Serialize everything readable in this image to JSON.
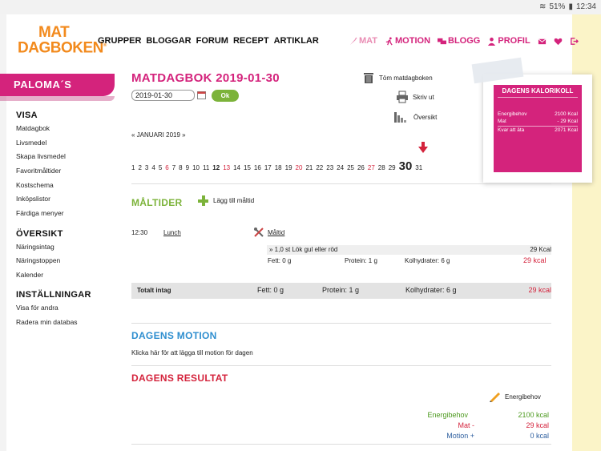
{
  "status": {
    "battery": "51%",
    "time": "12:34"
  },
  "logo": {
    "line1": "MAT",
    "line2": "DAGBOKEN",
    "reg": "®"
  },
  "main_nav": [
    "GRUPPER",
    "BLOGGAR",
    "FORUM",
    "RECEPT",
    "ARTIKLAR"
  ],
  "user_nav": {
    "mat": "MAT",
    "motion": "MOTION",
    "blogg": "BLOGG",
    "profil": "PROFIL"
  },
  "sidebar": {
    "user": "PALOMA´S",
    "visa_heading": "VISA",
    "visa_items": [
      "Matdagbok",
      "Livsmedel",
      "Skapa livsmedel",
      "Favoritmåltider",
      "Kostschema",
      "Inköpslistor",
      "Färdiga menyer"
    ],
    "oversikt_heading": "ÖVERSIKT",
    "oversikt_items": [
      "Näringsintag",
      "Näringstoppen",
      "Kalender"
    ],
    "installningar_heading": "INSTÄLLNINGAR",
    "installningar_items": [
      "Visa för andra",
      "Radera min databas"
    ]
  },
  "page": {
    "title": "MATDAGBOK 2019-01-30",
    "date_value": "2019-01-30",
    "ok_label": "Ok",
    "tools": {
      "clear": "Töm matdagboken",
      "print": "Skriv ut",
      "overview": "Översikt"
    }
  },
  "kcal": {
    "title": "DAGENS KALORIKOLL",
    "rows": [
      {
        "label": "Energibehov",
        "value": "2100 Kcal"
      },
      {
        "label": "Mat",
        "value": "- 29 Kcal"
      },
      {
        "label": "Kvar att äta",
        "value": "2071 Kcal"
      }
    ]
  },
  "calendar": {
    "month_label": "« JANUARI 2019 »",
    "days": [
      {
        "d": "1",
        "s": ""
      },
      {
        "d": "2",
        "s": ""
      },
      {
        "d": "3",
        "s": ""
      },
      {
        "d": "4",
        "s": ""
      },
      {
        "d": "5",
        "s": ""
      },
      {
        "d": "6",
        "s": "red"
      },
      {
        "d": "7",
        "s": ""
      },
      {
        "d": "8",
        "s": ""
      },
      {
        "d": "9",
        "s": ""
      },
      {
        "d": "10",
        "s": ""
      },
      {
        "d": "11",
        "s": ""
      },
      {
        "d": "12",
        "s": "bold"
      },
      {
        "d": "13",
        "s": "red"
      },
      {
        "d": "14",
        "s": ""
      },
      {
        "d": "15",
        "s": ""
      },
      {
        "d": "16",
        "s": ""
      },
      {
        "d": "17",
        "s": ""
      },
      {
        "d": "18",
        "s": ""
      },
      {
        "d": "19",
        "s": ""
      },
      {
        "d": "20",
        "s": "red"
      },
      {
        "d": "21",
        "s": ""
      },
      {
        "d": "22",
        "s": ""
      },
      {
        "d": "23",
        "s": ""
      },
      {
        "d": "24",
        "s": ""
      },
      {
        "d": "25",
        "s": ""
      },
      {
        "d": "26",
        "s": ""
      },
      {
        "d": "27",
        "s": "red"
      },
      {
        "d": "28",
        "s": ""
      },
      {
        "d": "29",
        "s": ""
      },
      {
        "d": "30",
        "s": "sel"
      },
      {
        "d": "31",
        "s": ""
      }
    ]
  },
  "meals": {
    "title": "MÅLTIDER",
    "add_label": "Lägg till måltid",
    "time": "12:30",
    "name": "Lunch",
    "link": "Måltid",
    "food": "» 1,0 st Lök gul eller röd",
    "food_kcal": "29 Kcal",
    "fat": "Fett: 0 g",
    "protein": "Protein: 1 g",
    "carbs": "Kolhydrater: 6 g",
    "kcal_big": "29 kcal"
  },
  "total": {
    "label": "Totalt intag",
    "fat": "Fett: 0 g",
    "protein": "Protein: 1 g",
    "carbs": "Kolhydrater: 6 g",
    "kcal": "29 kcal"
  },
  "motion": {
    "title": "DAGENS MOTION",
    "text": "Klicka här för att lägga till motion för dagen"
  },
  "result": {
    "title": "DAGENS RESULTAT",
    "edit_label": "Energibehov",
    "rows": [
      {
        "label": "Energibehov",
        "value": "2100 kcal",
        "color": "#4d9a1f"
      },
      {
        "label": "Mat  -",
        "value": "29 kcal",
        "color": "#d4233c"
      },
      {
        "label": "Motion +",
        "value": "0 kcal",
        "color": "#2e5f9f"
      }
    ]
  }
}
